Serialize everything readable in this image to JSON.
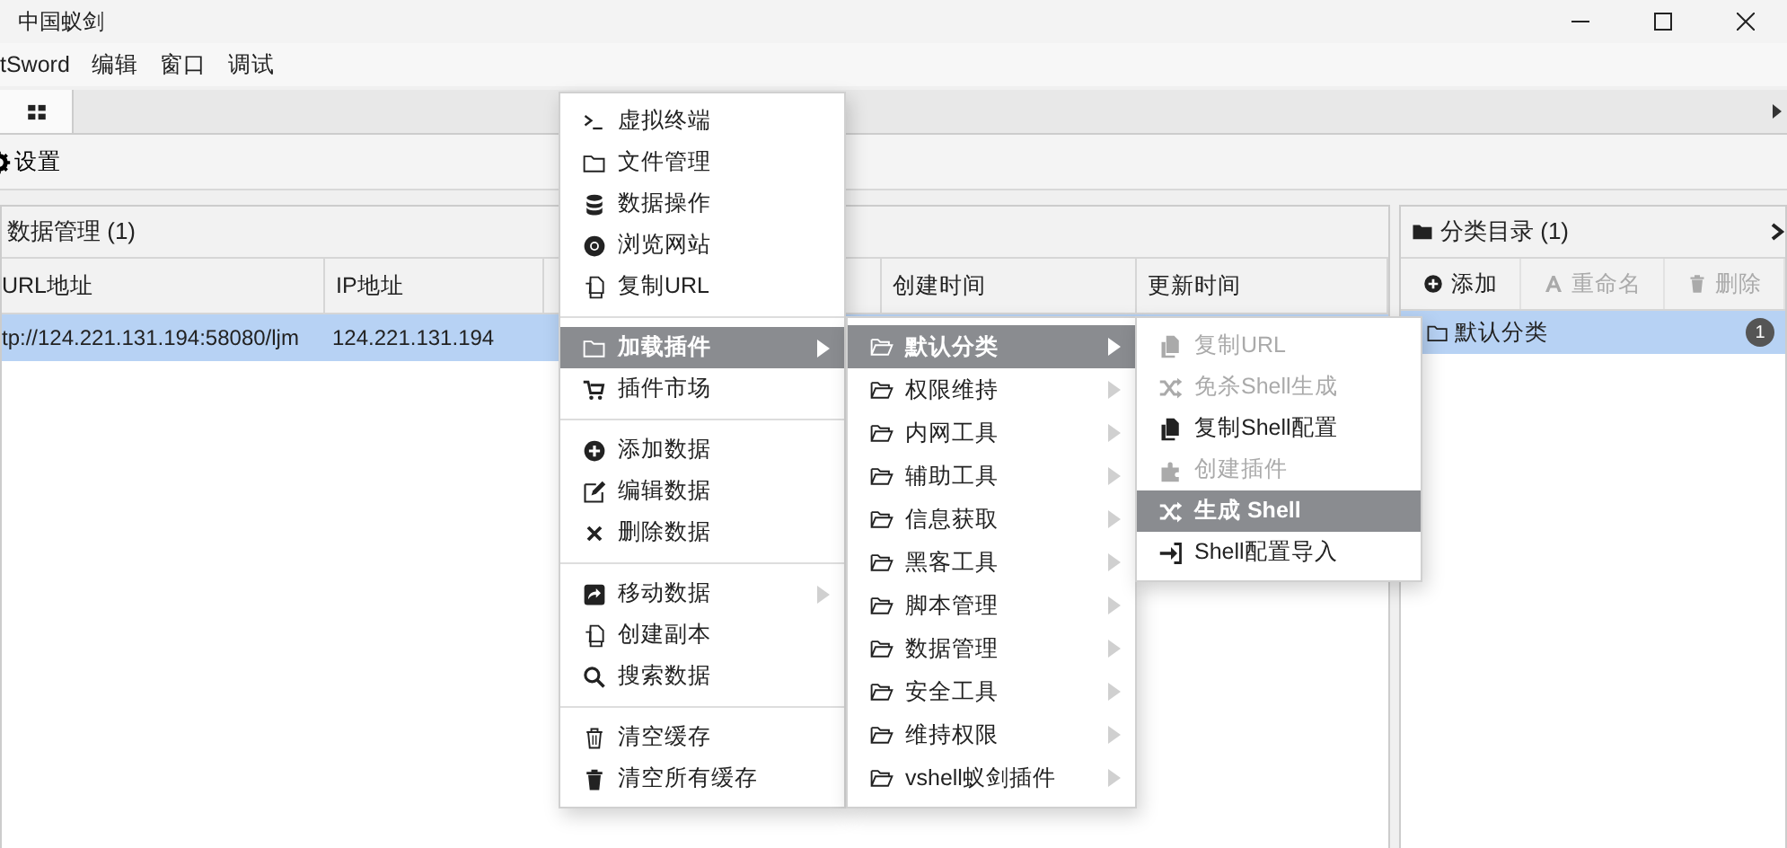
{
  "window": {
    "title": "中国蚁剑"
  },
  "menubar": [
    "tSword",
    "编辑",
    "窗口",
    "调试"
  ],
  "toolbar": {
    "settings_label": "设置"
  },
  "data_panel": {
    "title": "数据管理 (1)",
    "columns": [
      {
        "label": "URL地址"
      },
      {
        "label": "IP地址"
      },
      {
        "label": "创建时间"
      },
      {
        "label": "更新时间"
      }
    ],
    "rows": [
      {
        "selected": true,
        "cells": [
          "tp://124.221.131.194:58080/ljm",
          "124.221.131.194"
        ]
      }
    ]
  },
  "category_panel": {
    "title": "分类目录 (1)",
    "actions": [
      {
        "label": "添加",
        "disabled": false
      },
      {
        "label": "重命名",
        "disabled": true
      },
      {
        "label": "删除",
        "disabled": true
      }
    ],
    "items": [
      {
        "label": "默认分类",
        "count": "1",
        "selected": true
      }
    ]
  },
  "context_menu": {
    "groups": [
      [
        {
          "label": "虚拟终端",
          "selected": false,
          "submenu": false
        },
        {
          "label": "文件管理",
          "selected": false,
          "submenu": false
        },
        {
          "label": "数据操作",
          "selected": false,
          "submenu": false
        },
        {
          "label": "浏览网站",
          "selected": false,
          "submenu": false
        },
        {
          "label": "复制URL",
          "selected": false,
          "submenu": false
        }
      ],
      [
        {
          "label": "加载插件",
          "selected": true,
          "submenu": true
        },
        {
          "label": "插件市场",
          "selected": false,
          "submenu": false
        }
      ],
      [
        {
          "label": "添加数据",
          "selected": false,
          "submenu": false
        },
        {
          "label": "编辑数据",
          "selected": false,
          "submenu": false
        },
        {
          "label": "删除数据",
          "selected": false,
          "submenu": false
        }
      ],
      [
        {
          "label": "移动数据",
          "selected": false,
          "submenu": true
        },
        {
          "label": "创建副本",
          "selected": false,
          "submenu": false
        },
        {
          "label": "搜索数据",
          "selected": false,
          "submenu": false
        }
      ],
      [
        {
          "label": "清空缓存",
          "selected": false,
          "submenu": false
        },
        {
          "label": "清空所有缓存",
          "selected": false,
          "submenu": false
        }
      ]
    ]
  },
  "plugin_menu": {
    "items": [
      {
        "label": "默认分类",
        "selected": true,
        "submenu": true
      },
      {
        "label": "权限维持",
        "selected": false,
        "submenu": true
      },
      {
        "label": "内网工具",
        "selected": false,
        "submenu": true
      },
      {
        "label": "辅助工具",
        "selected": false,
        "submenu": true
      },
      {
        "label": "信息获取",
        "selected": false,
        "submenu": true
      },
      {
        "label": "黑客工具",
        "selected": false,
        "submenu": true
      },
      {
        "label": "脚本管理",
        "selected": false,
        "submenu": true
      },
      {
        "label": "数据管理",
        "selected": false,
        "submenu": true
      },
      {
        "label": "安全工具",
        "selected": false,
        "submenu": true
      },
      {
        "label": "维持权限",
        "selected": false,
        "submenu": true
      },
      {
        "label": "vshell蚁剑插件",
        "selected": false,
        "submenu": true
      }
    ]
  },
  "category_menu": {
    "items": [
      {
        "label": "复制URL",
        "selected": false,
        "disabled": true
      },
      {
        "label": "免杀Shell生成",
        "selected": false,
        "disabled": true
      },
      {
        "label": "复制Shell配置",
        "selected": false,
        "disabled": false
      },
      {
        "label": "创建插件",
        "selected": false,
        "disabled": true
      },
      {
        "label": "生成 Shell",
        "selected": true,
        "disabled": false
      },
      {
        "label": "Shell配置导入",
        "selected": false,
        "disabled": false
      }
    ]
  }
}
